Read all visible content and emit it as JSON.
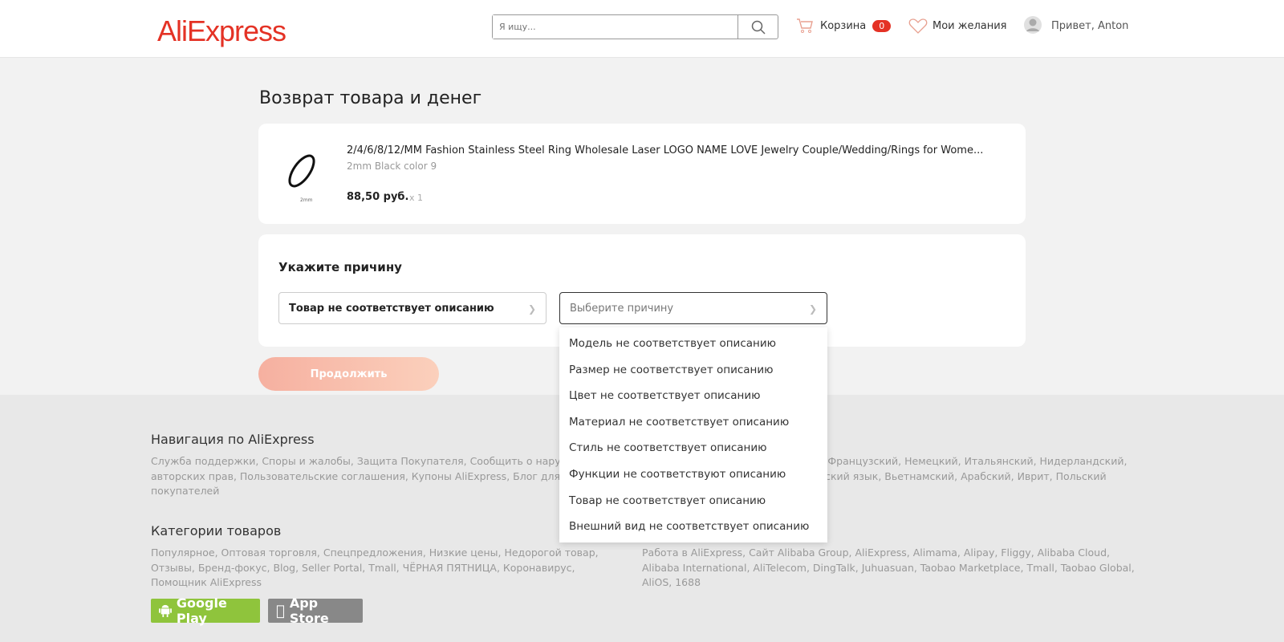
{
  "header": {
    "logo": "AliExpress",
    "search_placeholder": "Я ищу...",
    "cart_label": "Корзина",
    "cart_count": "0",
    "wishlist_label": "Мои желания",
    "greeting": "Привет, Anton"
  },
  "page": {
    "title": "Возврат товара и денег"
  },
  "product": {
    "name": "2/4/6/8/12/MM Fashion Stainless Steel Ring Wholesale Laser LOGO NAME LOVE Jewelry Couple/Wedding/Rings for Wome...",
    "variant": "2mm Black color 9",
    "price": "88,50 руб.",
    "qty": "x 1",
    "image_caption": "2mm"
  },
  "reason": {
    "heading": "Укажите причину",
    "primary_value": "Товар не соответствует описанию",
    "secondary_placeholder": "Выберите причину",
    "options": [
      "Модель не соответствует описанию",
      "Размер не соответствует описанию",
      "Цвет не соответствует описанию",
      "Материал не соответствует описанию",
      "Стиль не соответствует описанию",
      "Функции не соответствуют описанию",
      "Товар не соответствует описанию",
      "Внешний вид не соответствует описанию"
    ]
  },
  "continue_label": "Продолжить",
  "colors": {
    "brand": "#e43225",
    "continue_button": "#f6b4a6"
  },
  "footer": {
    "nav_title": "Навигация по AliExpress",
    "nav_lines": [
      "Служба поддержки, Споры и жалобы, Защита Покупателя, Сообщить о наруше",
      "авторских прав, Пользовательские соглашения, Купоны AliExpress, Блог для",
      "покупателей"
    ],
    "lang_lines": [
      "i, Французский, Немецкий, Итальянский, Нидерландский,",
      "йский язык, Вьетнамский, Арабский, Иврит, Польский"
    ],
    "cat_title": "Категории товаров",
    "cat_lines": [
      "Популярное, Оптовая торговля, Спецпредложения, Низкие цены, Недорогой товар,",
      "Отзывы, Бренд-фокус, Blog, Seller Portal, Tmall, ЧЁРНАЯ ПЯТНИЦА, Коронавирус,",
      "Помощник AliExpress"
    ],
    "group_lines": [
      "Работа в AliExpress, Сайт Alibaba Group, AliExpress, Alimama, Alipay, Fliggy, Alibaba Cloud,",
      "Alibaba International, AliTelecom, DingTalk, Juhuasuan, Taobao Marketplace, Tmall, Taobao Global,",
      "AliOS, 1688"
    ],
    "google_play": "Google Play",
    "app_store": "App Store"
  }
}
